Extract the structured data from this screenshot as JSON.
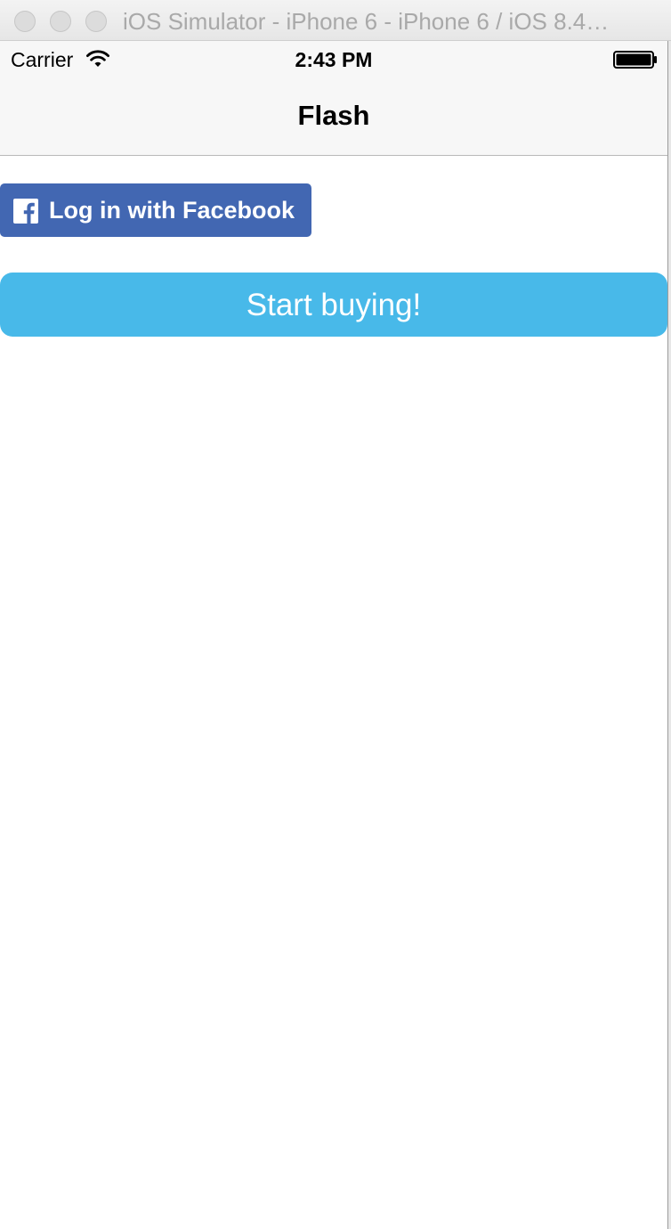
{
  "window": {
    "title": "iOS Simulator - iPhone 6 - iPhone 6 / iOS 8.4…"
  },
  "status_bar": {
    "carrier": "Carrier",
    "time": "2:43 PM",
    "wifi_icon": "wifi-icon",
    "battery_icon": "battery-full-icon"
  },
  "nav_bar": {
    "title": "Flash"
  },
  "main": {
    "facebook_login_label": "Log in with Facebook",
    "facebook_icon": "facebook-f-icon",
    "start_button_label": "Start buying!"
  },
  "colors": {
    "facebook_blue": "#4267b2",
    "start_button": "#48b9e9",
    "nav_background": "#f7f7f7"
  }
}
